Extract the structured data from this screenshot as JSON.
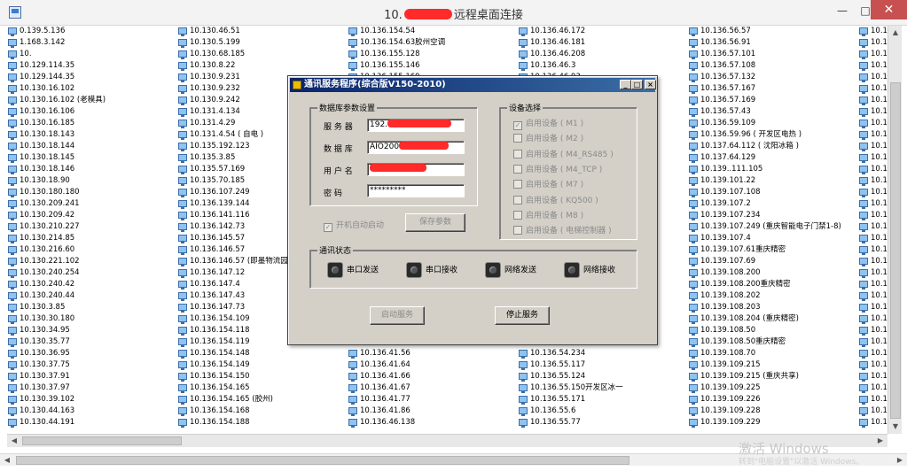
{
  "window": {
    "title_prefix": "10.",
    "title_suffix": "远程桌面连接",
    "min": "—",
    "max": "□",
    "close": "✕"
  },
  "remote_list": {
    "columns": [
      [
        "0.139.5.136",
        "1.168.3.142",
        "10.",
        "10.129.114.35",
        "10.129.144.35",
        "10.130.16.102",
        "10.130.16.102 (老模具)",
        "10.130.16.106",
        "10.130.16.185",
        "10.130.18.143",
        "10.130.18.144",
        "10.130.18.145",
        "10.130.18.146",
        "10.130.18.90",
        "10.130.180.180",
        "10.130.209.241",
        "10.130.209.42",
        "10.130.210.227",
        "10.130.214.85",
        "10.130.216.60",
        "10.130.221.102",
        "10.130.240.254",
        "10.130.240.42",
        "10.130.240.44",
        "10.130.3.85",
        "10.130.30.180",
        "10.130.34.95",
        "10.130.35.77",
        "10.130.36.95",
        "10.130.37.75",
        "10.130.37.91",
        "10.130.37.97",
        "10.130.39.102",
        "10.130.44.163",
        "10.130.44.191"
      ],
      [
        "10.130.46.51",
        "10.130.5.199",
        "10.130.68.185",
        "10.130.8.22",
        "10.130.9.231",
        "10.130.9.232",
        "10.130.9.242",
        "10.131.4.134",
        "10.131.4.29",
        "10.131.4.54 ( 自电 )",
        "10.135.192.123",
        "10.135.3.85",
        "10.135.57.169",
        "10.135.70.185",
        "10.136.107.249",
        "10.136.139.144",
        "10.136.141.116",
        "10.136.142.73",
        "10.136.145.57",
        "10.136.146.57",
        "10.136.146.57 (即墨物流园",
        "10.136.147.12",
        "10.136.147.4",
        "10.136.147.43",
        "10.136.147.73",
        "10.136.154.109",
        "10.136.154.118",
        "10.136.154.119",
        "10.136.154.148",
        "10.136.154.149",
        "10.136.154.150",
        "10.136.154.165",
        "10.136.154.165 (胶州)",
        "10.136.154.168",
        "10.136.154.188"
      ],
      [
        "10.136.154.54",
        "10.136.154.63胶州空调",
        "10.136.155.128",
        "10.136.155.146",
        "10.136.155.169",
        "",
        "",
        "",
        "",
        "",
        "",
        "",
        "",
        "",
        "",
        "",
        "",
        "",
        "",
        "",
        "",
        "",
        "",
        "",
        "",
        "",
        "",
        "",
        "10.136.41.56",
        "10.136.41.64",
        "10.136.41.66",
        "10.136.41.67",
        "10.136.41.77",
        "10.136.41.86",
        "10.136.46.138"
      ],
      [
        "10.136.46.172",
        "10.136.46.181",
        "10.136.46.208",
        "10.136.46.3",
        "10.136.46.93",
        "",
        "",
        "",
        "",
        "",
        "",
        "",
        "",
        "",
        "",
        "",
        "",
        "",
        "",
        "",
        "",
        "",
        "",
        "",
        "",
        "",
        "",
        "",
        "10.136.54.234",
        "10.136.55.117",
        "10.136.55.124",
        "10.136.55.150开发区冰一",
        "10.136.55.171",
        "10.136.55.6",
        "10.136.55.77"
      ],
      [
        "10.136.56.57",
        "10.136.56.91",
        "10.136.57.101",
        "10.136.57.108",
        "10.136.57.132",
        "10.136.57.167",
        "10.136.57.169",
        "10.136.57.43",
        "10.136.59.109",
        "10.136.59.96 ( 开发区电热 )",
        "10.137.64.112 ( 沈阳冰箱 )",
        "10.137.64.129",
        "10.139..111.105",
        "10.139.101.22",
        "10.139.107.108",
        "10.139.107.2",
        "10.139.107.234",
        "10.139.107.249 (重庆智能电子门禁1-8)",
        "10.139.107.4",
        "10.139.107.61重庆精密",
        "10.139.107.69",
        "10.139.108.200",
        "10.139.108.200重庆精密",
        "10.139.108.202",
        "10.139.108.203",
        "10.139.108.204 (重庆精密)",
        "10.139.108.50",
        "10.139.108.50重庆精密",
        "10.139.108.70",
        "10.139.109.215",
        "10.139.109.215 (重庆共享)",
        "10.139.109.225",
        "10.139.109.226",
        "10.139.109.228",
        "10.139.109.229"
      ],
      [
        "10.1",
        "10.1",
        "10.1",
        "10.1",
        "10.1",
        "10.1",
        "10.1",
        "10.1",
        "10.1",
        "10.1",
        "10.1",
        "10.1",
        "10.1",
        "10.1",
        "10.1",
        "10.1",
        "10.1",
        "10.1",
        "10.1",
        "10.1",
        "10.1",
        "10.1",
        "10.1",
        "10.1",
        "10.1",
        "10.1",
        "10.1",
        "10.1",
        "10.1",
        "10.1",
        "10.1",
        "10.1",
        "10.1",
        "10.1",
        "10.1"
      ]
    ]
  },
  "dialog": {
    "title": "通讯服务程序(综合版V150-2010)",
    "db_group": {
      "label": "数据库参数设置",
      "server_label": "服 务 器",
      "server_value": "192.",
      "database_label": "数 据 库",
      "database_value": "AIO200",
      "user_label": "用 户 名",
      "user_value": "",
      "password_label": "密    码",
      "password_value": "*********"
    },
    "autostart_label": "开机自动启动",
    "save_button": "保存参数",
    "device_group": {
      "label": "设备选择",
      "devices": [
        "启用设备 ( M1 )",
        "启用设备 ( M2 )",
        "启用设备 ( M4_RS485 )",
        "启用设备 ( M4_TCP )",
        "启用设备 ( M7 )",
        "启用设备 ( KQ500 )",
        "启用设备 ( M8 )",
        "启用设备 ( 电梯控制器 )"
      ]
    },
    "comm_group": {
      "label": "通讯状态",
      "serial_send": "串口发送",
      "serial_recv": "串口接收",
      "net_send": "网络发送",
      "net_recv": "网络接收"
    },
    "start_button": "启动服务",
    "stop_button": "停止服务"
  },
  "watermark": {
    "line1": "激活 Windows",
    "line2": "转到\"电脑设置\"以激活 Windows。"
  }
}
